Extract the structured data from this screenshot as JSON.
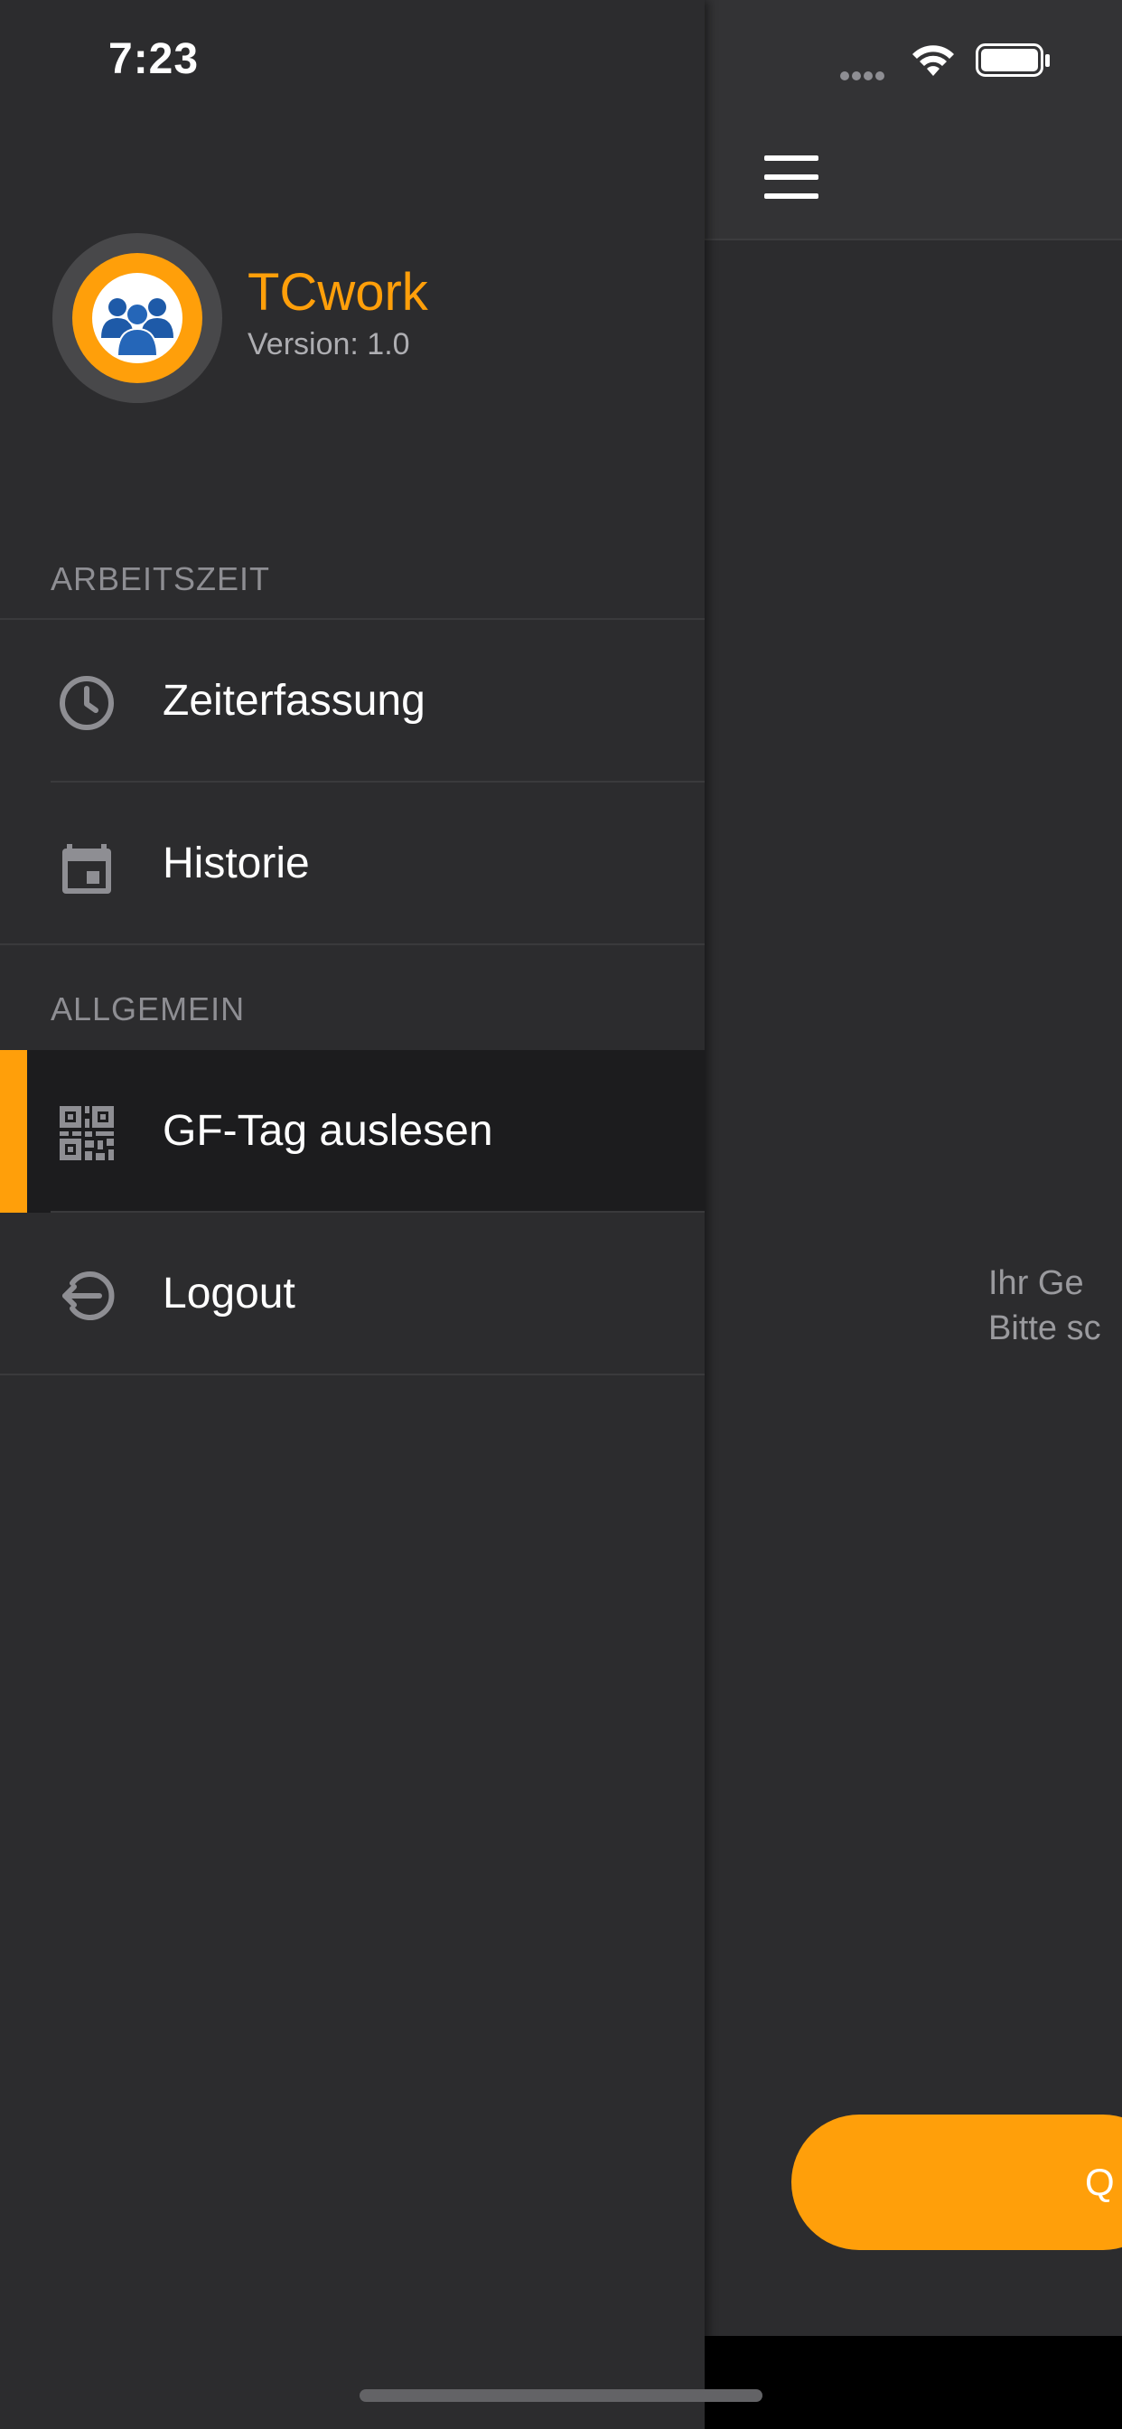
{
  "status_bar": {
    "time": "7:23"
  },
  "app": {
    "name": "TCwork",
    "version": "Version:  1.0"
  },
  "drawer": {
    "sections": [
      {
        "title": "ARBEITSZEIT",
        "items": [
          {
            "label": "Zeiterfassung",
            "icon": "clock-icon"
          },
          {
            "label": "Historie",
            "icon": "calendar-icon"
          }
        ]
      },
      {
        "title": "ALLGEMEIN",
        "items": [
          {
            "label": "GF-Tag auslesen",
            "icon": "qr-code-icon",
            "active": true
          },
          {
            "label": "Logout",
            "icon": "logout-icon"
          }
        ]
      }
    ]
  },
  "main": {
    "message_line1": "Ihr Ge",
    "message_line2": "Bitte sc",
    "button_label": "Q"
  },
  "colors": {
    "accent": "#ff9f0a",
    "drawer_bg": "#2c2c2e",
    "active_bg": "#1c1c1e",
    "section_text": "#8e8e93"
  }
}
